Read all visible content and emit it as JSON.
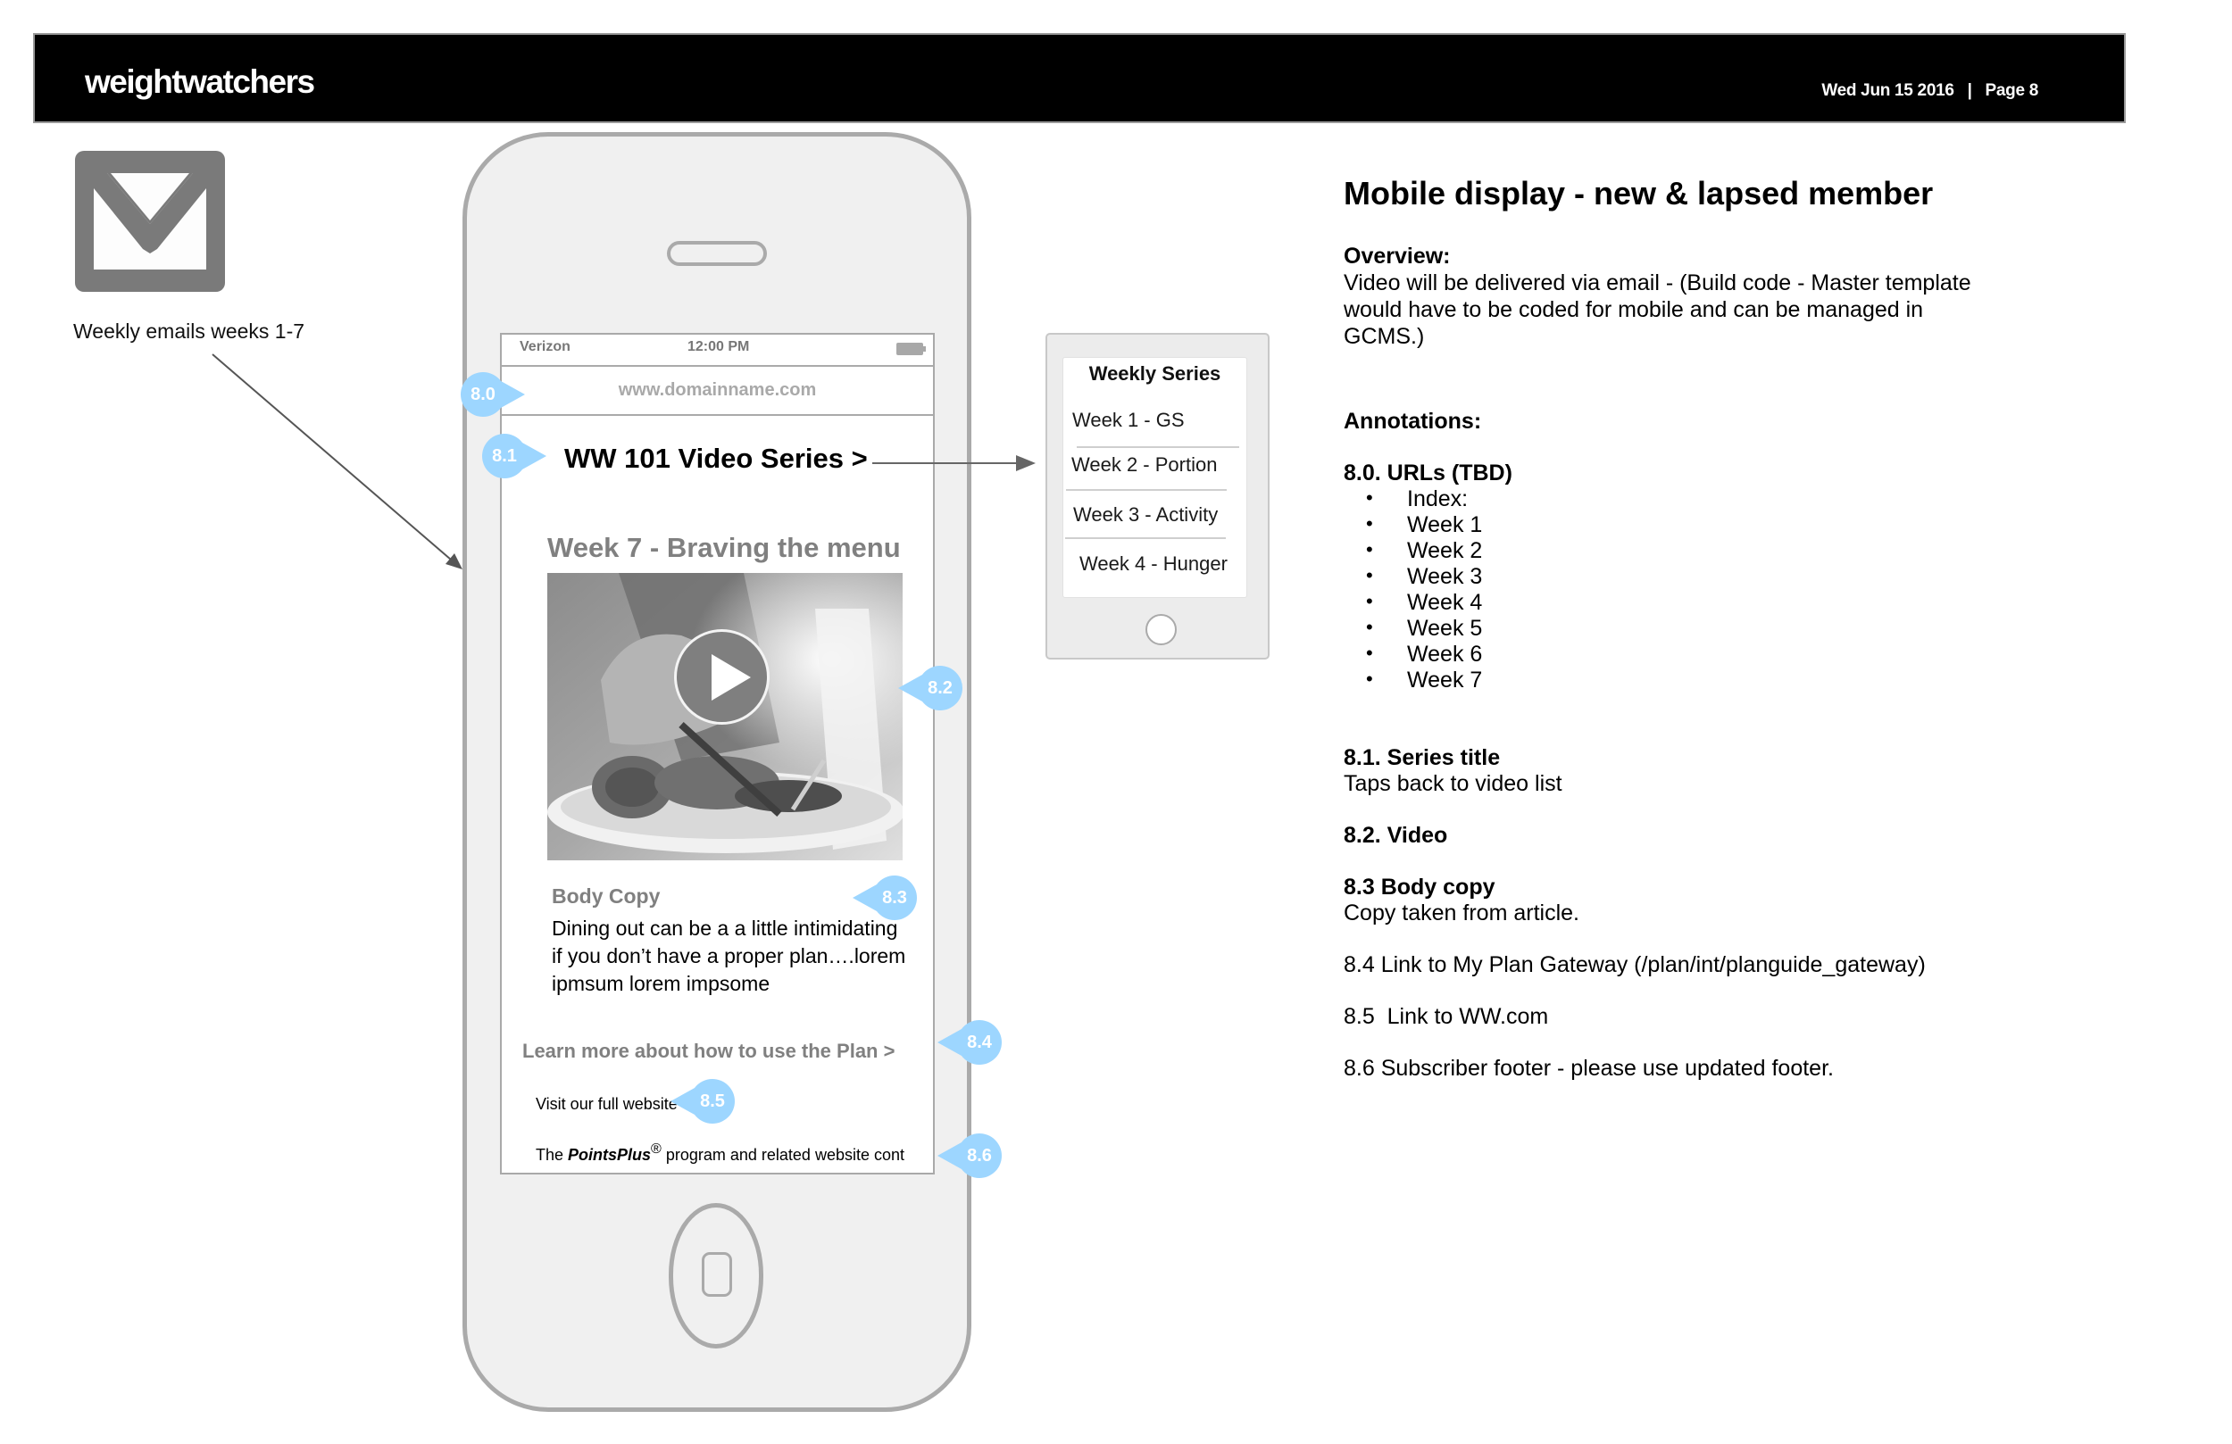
{
  "header": {
    "brand": "weightwatchers",
    "date": "Wed Jun 15 2016",
    "separator": "|",
    "page": "Page 8"
  },
  "left": {
    "icon": "envelope-icon",
    "label": "Weekly emails weeks 1-7"
  },
  "phone": {
    "status_bar": {
      "carrier": "Verizon",
      "time": "12:00 PM",
      "battery_icon": "battery-icon"
    },
    "url": "www.domainname.com",
    "series_title": "WW 101 Video Series >",
    "week_heading": "Week 7 - Braving the menu",
    "video": {
      "play_icon": "play-icon",
      "image": "dining-plate-photo"
    },
    "body_label": "Body Copy",
    "body_text": "Dining out can be a a little intimidating if you don’t have a proper plan….lorem ipmsum lorem impsome",
    "learn_more": "Learn more about how to use the Plan >",
    "visit_link": "Visit our full website",
    "footer": {
      "prefix": "The ",
      "brand": "PointsPlus",
      "reg": "®",
      "suffix": " program and related website cont"
    }
  },
  "annotation_markers": [
    "8.0",
    "8.1",
    "8.2",
    "8.3",
    "8.4",
    "8.5",
    "8.6"
  ],
  "series_panel": {
    "title": "Weekly Series",
    "items": [
      "Week 1 - GS",
      "Week 2 - Portion",
      "Week 3 - Activity",
      "Week 4 - Hunger"
    ]
  },
  "notes": {
    "title": "Mobile display - new & lapsed member",
    "overview_heading": "Overview:",
    "overview_lines": [
      "Video will be delivered via email - (Build code - Master template",
      "would have to be coded for mobile and can be managed in",
      "GCMS.)"
    ],
    "annotations_heading": "Annotations:",
    "urls_heading": "8.0. URLs (TBD)",
    "urls": [
      "Index:",
      "Week 1",
      "Week 2",
      "Week 3",
      "Week 4",
      "Week 5",
      "Week 6",
      "Week 7"
    ],
    "series_title_heading": "8.1. Series title",
    "series_title_desc": "Taps back to video list",
    "video_heading": "8.2. Video",
    "body_heading": "8.3 Body copy",
    "body_desc": "Copy taken from article.",
    "link_plan": "8.4 Link to My Plan Gateway (/plan/int/planguide_gateway)",
    "link_ww": "8.5  Link to WW.com",
    "footer_note": "8.6 Subscriber footer - please use updated footer."
  },
  "colors": {
    "header_bg": "#000000",
    "marker": "#9dd6ff",
    "phone_frame": "#aaaaaa",
    "muted_text": "#808080"
  }
}
